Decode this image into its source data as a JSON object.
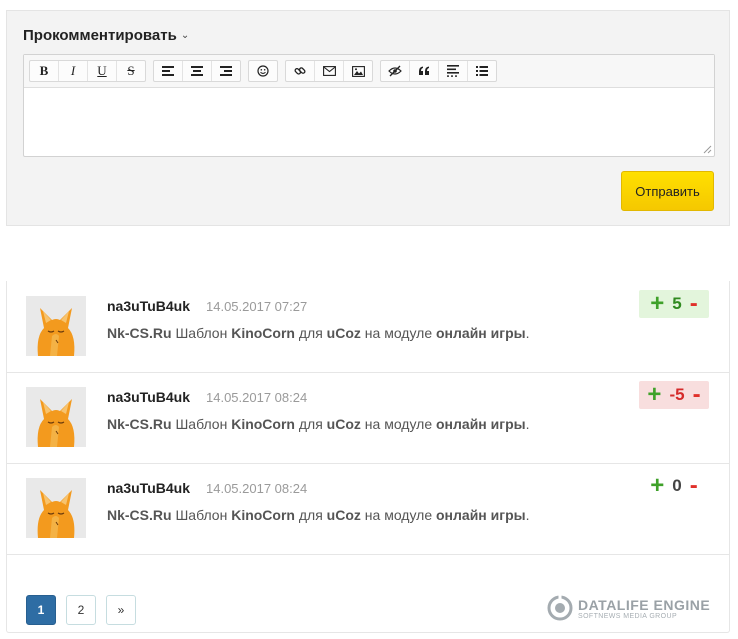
{
  "comment_form": {
    "title": "Прокомментировать",
    "toolbar_groups": [
      [
        "B",
        "I",
        "U",
        "S"
      ],
      [
        "align-left-icon",
        "align-center-icon",
        "align-right-icon"
      ],
      [
        "smiley-icon"
      ],
      [
        "link-icon",
        "email-icon",
        "image-icon"
      ],
      [
        "hide-icon",
        "quote-icon",
        "spoiler-icon",
        "list-icon"
      ]
    ],
    "submit_label": "Отправить"
  },
  "comments": [
    {
      "author": "na3uTuB4uk",
      "date": "14.05.2017 07:27",
      "site": "Nk-CS.Ru",
      "t1": "Шаблон",
      "template": "KinoCorn",
      "t2": "для",
      "cms": "uCoz",
      "t3": "на модуле",
      "module": "онлайн игры",
      "dot": ".",
      "rating": "5",
      "rating_state": "positive"
    },
    {
      "author": "na3uTuB4uk",
      "date": "14.05.2017 08:24",
      "site": "Nk-CS.Ru",
      "t1": "Шаблон",
      "template": "KinoCorn",
      "t2": "для",
      "cms": "uCoz",
      "t3": "на модуле",
      "module": "онлайн игры",
      "dot": ".",
      "rating": "-5",
      "rating_state": "negative"
    },
    {
      "author": "na3uTuB4uk",
      "date": "14.05.2017 08:24",
      "site": "Nk-CS.Ru",
      "t1": "Шаблон",
      "template": "KinoCorn",
      "t2": "для",
      "cms": "uCoz",
      "t3": "на модуле",
      "module": "онлайн игры",
      "dot": ".",
      "rating": "0",
      "rating_state": "neutral"
    }
  ],
  "rating_controls": {
    "plus": "+",
    "minus": "-"
  },
  "pagination": {
    "pages": [
      "1",
      "2"
    ],
    "current": "1",
    "next": "»"
  },
  "footer_logo": {
    "title": "DATALIFE ENGINE",
    "subtitle": "SOFTNEWS MEDIA GROUP"
  },
  "colors": {
    "accent_yellow": "#f5c800",
    "positive": "#3fa12a",
    "negative": "#e0302a",
    "page_active": "#2e6da4"
  }
}
